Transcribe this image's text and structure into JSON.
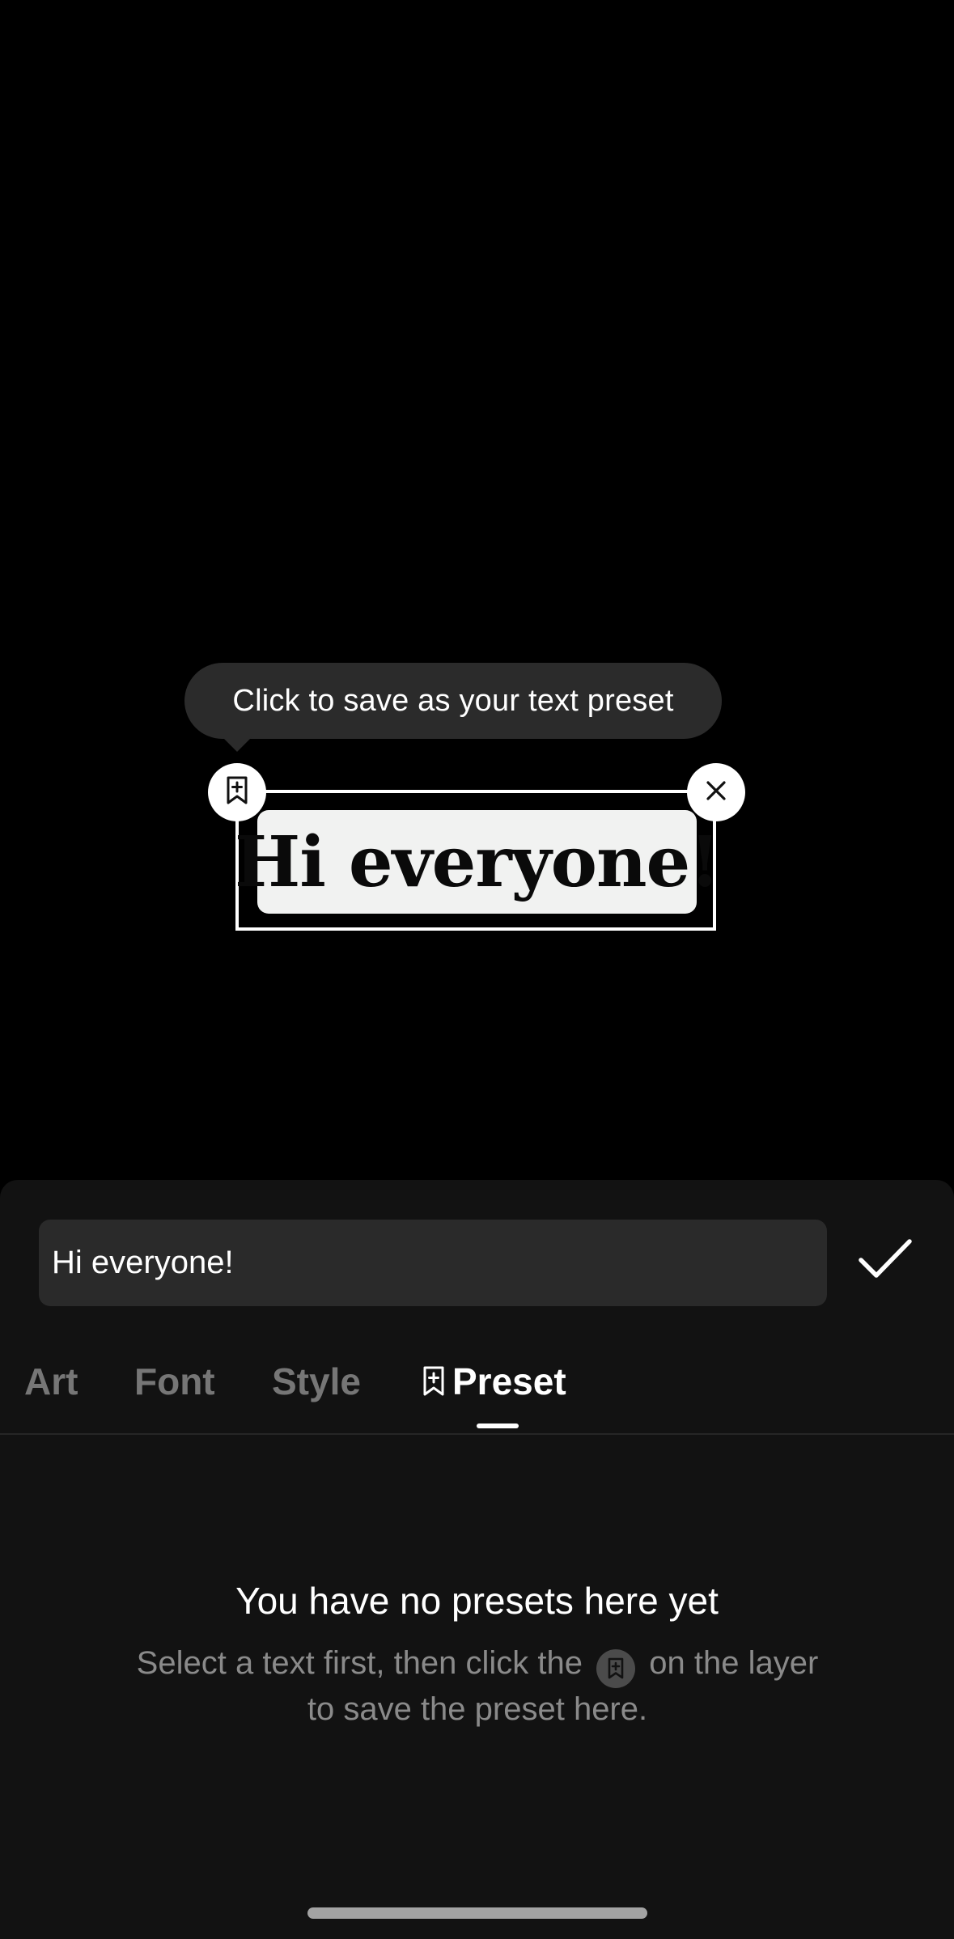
{
  "canvas": {
    "tooltip_text": "Click to save as your text preset",
    "layer_text": "Hi everyone!",
    "save_handle_icon": "bookmark-plus-icon",
    "close_handle_icon": "close-icon"
  },
  "editor": {
    "input_value": "Hi everyone!",
    "confirm_icon": "checkmark-icon"
  },
  "tabs": [
    {
      "label": "Art",
      "active": false
    },
    {
      "label": "Font",
      "active": false
    },
    {
      "label": "Style",
      "active": false
    },
    {
      "label": "Preset",
      "active": true,
      "icon": "bookmark-plus-icon"
    }
  ],
  "empty_state": {
    "title": "You have no presets here yet",
    "desc_part1": "Select a text first, then click the",
    "desc_icon": "bookmark-plus-icon",
    "desc_part2": "on the layer to save the preset here."
  },
  "colors": {
    "canvas_bg": "#000000",
    "panel_bg": "#121212",
    "input_bg": "#2a2a2a",
    "tooltip_bg": "#2b2b2b",
    "tab_inactive": "#767676",
    "tab_active": "#ffffff",
    "text_box_bg": "#f1f2f1"
  }
}
